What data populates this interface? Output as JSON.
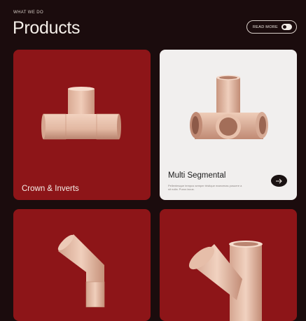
{
  "header": {
    "eyebrow": "WHAT WE DO",
    "title": "Products",
    "read_more_label": "READ MORE"
  },
  "cards": [
    {
      "label": "Crown & Inverts",
      "theme": "red"
    },
    {
      "label": "Multi Segmental",
      "theme": "light",
      "description": "Pellentesque tempus semper tristique maecenas posuere a sit nulla. Purus lacus."
    },
    {
      "label": "",
      "theme": "red"
    },
    {
      "label": "",
      "theme": "red"
    }
  ],
  "colors": {
    "background": "#1b0c0d",
    "card_red": "#8d1518",
    "card_light": "#f1efee",
    "pipe": "#e7c3ae"
  },
  "icons": [
    "toggle-icon",
    "arrow-right-icon"
  ]
}
